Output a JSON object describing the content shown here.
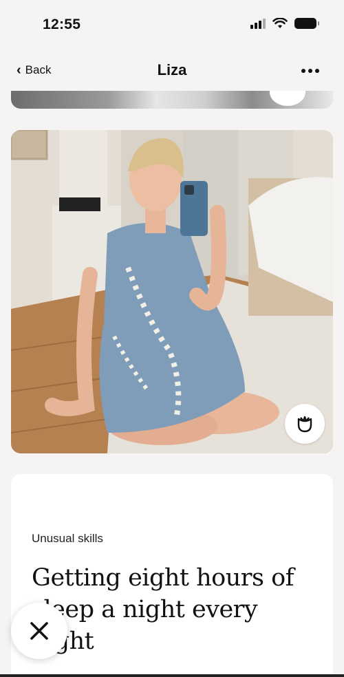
{
  "status_bar": {
    "time": "12:55"
  },
  "nav": {
    "back_label": "Back",
    "title": "Liza"
  },
  "icons": {
    "back": "chevron-left-icon",
    "more": "ellipsis-icon",
    "like": "rose-icon",
    "dismiss": "close-icon",
    "signal": "cellular-signal-icon",
    "wifi": "wifi-icon",
    "battery": "battery-icon"
  },
  "photo": {
    "alt": "Woman in blue floral dress taking a mirror selfie while sitting on the floor"
  },
  "prompt": {
    "label": "Unusual skills",
    "answer": "Getting eight hours of sleep a night every night"
  },
  "colors": {
    "background": "#f5f4f2",
    "card": "#ffffff",
    "text": "#111111"
  }
}
